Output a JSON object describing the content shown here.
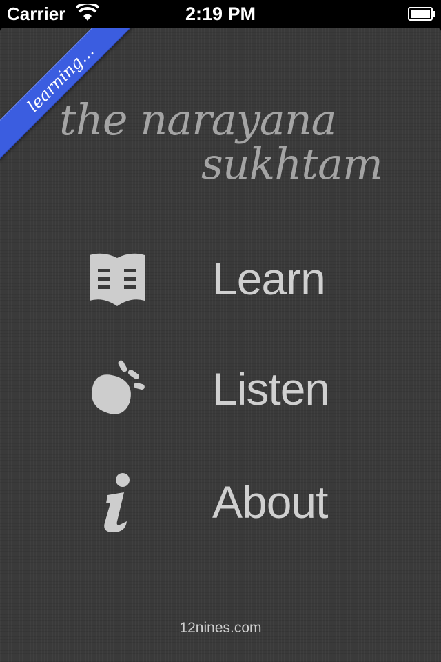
{
  "status_bar": {
    "carrier": "Carrier",
    "time": "2:19 PM"
  },
  "ribbon": {
    "label": "learning..."
  },
  "title": {
    "line1": "the narayana",
    "line2": "sukhtam"
  },
  "menu": {
    "items": [
      {
        "label": "Learn",
        "icon": "book-icon"
      },
      {
        "label": "Listen",
        "icon": "sound-icon"
      },
      {
        "label": "About",
        "icon": "info-icon"
      }
    ]
  },
  "footer": {
    "text": "12nines.com"
  },
  "colors": {
    "background": "#3a3a3a",
    "ribbon": "#3b5de0",
    "text": "#d0d0d0",
    "title": "#a4a4a4"
  }
}
